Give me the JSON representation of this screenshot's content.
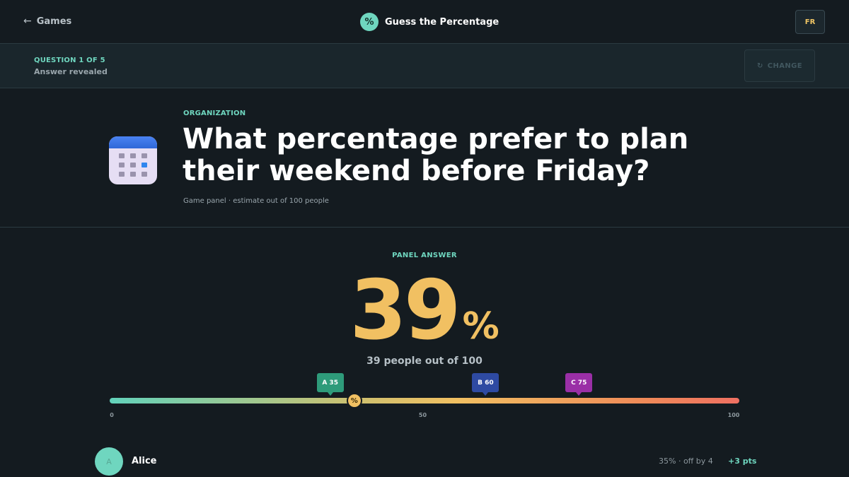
{
  "header": {
    "back_label": "Games",
    "brand_badge": "%",
    "title": "Guess the Percentage",
    "language": "FR"
  },
  "status": {
    "question_count": "QUESTION 1 OF 5",
    "state": "Answer revealed",
    "change_label": "CHANGE"
  },
  "question": {
    "category": "ORGANIZATION",
    "text": "What percentage prefer to plan their weekend before Friday?",
    "subtitle": "Game panel · estimate out of 100 people",
    "icon": "calendar-icon"
  },
  "answer": {
    "label": "PANEL ANSWER",
    "value": "39",
    "percent_sign": "%",
    "people_text": "39 people out of 100"
  },
  "slider": {
    "min": 0,
    "max": 100,
    "answer_value": 39,
    "knob_symbol": "%",
    "tick_labels": [
      "0",
      "50",
      "100"
    ],
    "tick_values": [
      0,
      50,
      100
    ],
    "guesses": [
      {
        "label": "A 35",
        "value": 35,
        "color": "#2e9b7a"
      },
      {
        "label": "B 60",
        "value": 60,
        "color": "#2e4aa2"
      },
      {
        "label": "C 75",
        "value": 75,
        "color": "#9a2fa6"
      }
    ]
  },
  "results": [
    {
      "initial": "A",
      "name": "Alice",
      "guess_text": "35% · off by 4",
      "points": "+3 pts"
    }
  ],
  "colors": {
    "accent": "#6fd6bf",
    "answer": "#f1c062",
    "background": "#141b20"
  }
}
